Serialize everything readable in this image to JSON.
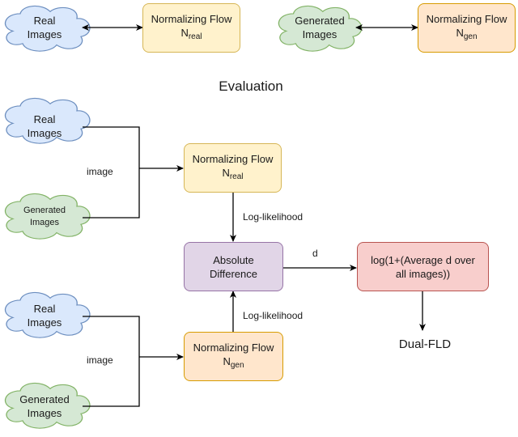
{
  "title": "Evaluation",
  "training": {
    "real_cloud": [
      "Real",
      "Images"
    ],
    "real_flow": {
      "line1": "Normalizing Flow",
      "base": "N",
      "sub": "real"
    },
    "gen_cloud": [
      "Generated",
      "Images"
    ],
    "gen_flow": {
      "line1": "Normalizing Flow",
      "base": "N",
      "sub": "gen"
    }
  },
  "evaluation": {
    "top": {
      "real_cloud": [
        "Real",
        "Images"
      ],
      "gen_cloud": [
        "Generated",
        "Images"
      ],
      "edge_label": "image",
      "flow": {
        "line1": "Normalizing Flow",
        "base": "N",
        "sub": "real"
      },
      "output_label": "Log-likelihood"
    },
    "bottom": {
      "real_cloud": [
        "Real",
        "Images"
      ],
      "gen_cloud": [
        "Generated",
        "Images"
      ],
      "edge_label": "image",
      "flow": {
        "line1": "Normalizing Flow",
        "base": "N",
        "sub": "gen"
      },
      "output_label": "Log-likelihood"
    },
    "abs_diff": [
      "Absolute",
      "Difference"
    ],
    "d_label": "d",
    "log_box": [
      "log(1+(Average d over",
      "all images))"
    ],
    "result": "Dual-FLD"
  },
  "colors": {
    "real_fill": "#dae8fc",
    "real_stroke": "#6c8ebf",
    "gen_fill": "#d5e8d4",
    "gen_stroke": "#82b366",
    "yellow_fill": "#fff2cc",
    "orange_fill": "#ffe6cc",
    "purple_fill": "#e1d5e7",
    "red_fill": "#f8cecc"
  }
}
